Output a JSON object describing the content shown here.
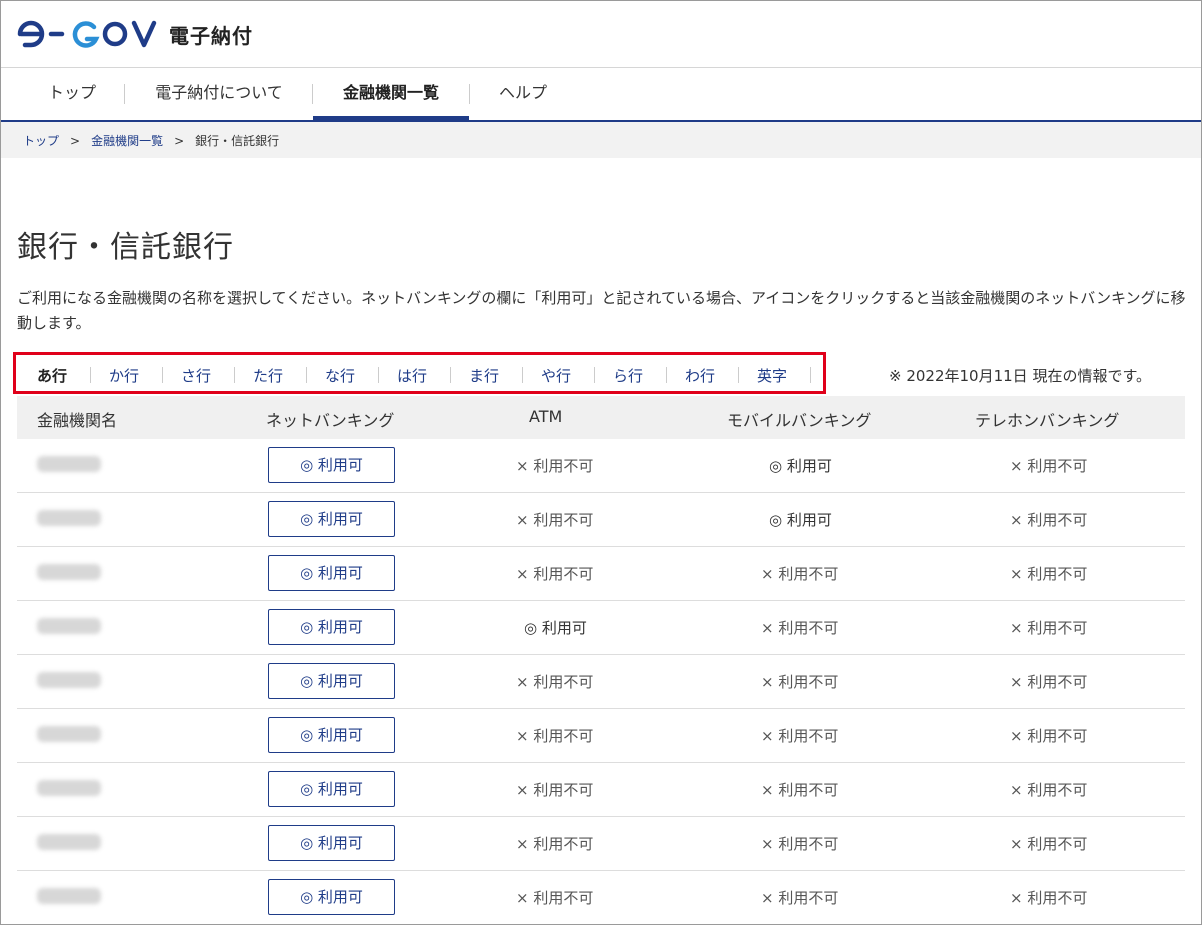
{
  "header": {
    "logo_text": "e-GOV",
    "site_title": "電子納付",
    "colors": {
      "brand_navy": "#1f3c88",
      "brand_blue": "#2b8fd6"
    }
  },
  "nav": {
    "items": [
      {
        "label": "トップ"
      },
      {
        "label": "電子納付について"
      },
      {
        "label": "金融機関一覧",
        "active": true
      },
      {
        "label": "ヘルプ"
      }
    ]
  },
  "breadcrumb": {
    "items": [
      {
        "label": "トップ"
      },
      {
        "label": "金融機関一覧"
      },
      {
        "label": "銀行・信託銀行"
      }
    ],
    "separator": ">"
  },
  "page": {
    "title": "銀行・信託銀行",
    "description": "ご利用になる金融機関の名称を選択してください。ネットバンキングの欄に「利用可」と記されている場合、アイコンをクリックすると当該金融機関のネットバンキングに移動します。",
    "as_of": "※ 2022年10月11日 現在の情報です。"
  },
  "alpha_nav": {
    "items": [
      {
        "label": "あ行",
        "active": true
      },
      {
        "label": "か行"
      },
      {
        "label": "さ行"
      },
      {
        "label": "た行"
      },
      {
        "label": "な行"
      },
      {
        "label": "は行"
      },
      {
        "label": "ま行"
      },
      {
        "label": "や行"
      },
      {
        "label": "ら行"
      },
      {
        "label": "わ行"
      },
      {
        "label": "英字"
      }
    ],
    "highlight_color": "#e0001a"
  },
  "table": {
    "headers": [
      "金融機関名",
      "ネットバンキング",
      "ATM",
      "モバイルバンキング",
      "テレホンバンキング"
    ],
    "ok_label": "◎ 利用可",
    "ng_label": "× 利用不可",
    "rows": [
      {
        "net_banking": "◎ 利用可",
        "atm": "× 利用不可",
        "mobile": "◎ 利用可",
        "telephone": "× 利用不可"
      },
      {
        "net_banking": "◎ 利用可",
        "atm": "× 利用不可",
        "mobile": "◎ 利用可",
        "telephone": "× 利用不可"
      },
      {
        "net_banking": "◎ 利用可",
        "atm": "× 利用不可",
        "mobile": "× 利用不可",
        "telephone": "× 利用不可"
      },
      {
        "net_banking": "◎ 利用可",
        "atm": "◎ 利用可",
        "mobile": "× 利用不可",
        "telephone": "× 利用不可"
      },
      {
        "net_banking": "◎ 利用可",
        "atm": "× 利用不可",
        "mobile": "× 利用不可",
        "telephone": "× 利用不可"
      },
      {
        "net_banking": "◎ 利用可",
        "atm": "× 利用不可",
        "mobile": "× 利用不可",
        "telephone": "× 利用不可"
      },
      {
        "net_banking": "◎ 利用可",
        "atm": "× 利用不可",
        "mobile": "× 利用不可",
        "telephone": "× 利用不可"
      },
      {
        "net_banking": "◎ 利用可",
        "atm": "× 利用不可",
        "mobile": "× 利用不可",
        "telephone": "× 利用不可"
      },
      {
        "net_banking": "◎ 利用可",
        "atm": "× 利用不可",
        "mobile": "× 利用不可",
        "telephone": "× 利用不可"
      }
    ]
  }
}
